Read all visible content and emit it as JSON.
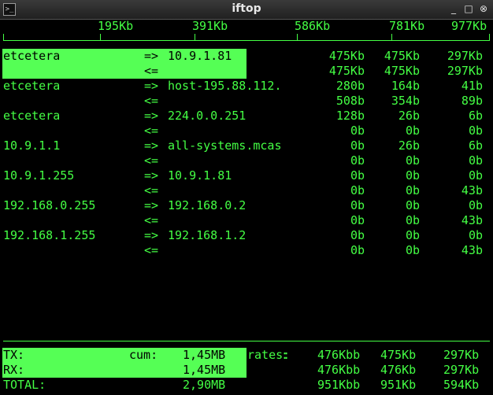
{
  "window": {
    "title": "iftop",
    "buttons": [
      "_",
      "□",
      "⊗"
    ]
  },
  "scale": {
    "ticks": [
      "195Kb",
      "391Kb",
      "586Kb",
      "781Kb",
      "977Kb"
    ]
  },
  "flows": [
    {
      "src": "etcetera",
      "dst": "10.9.1.81",
      "tx": [
        "475Kb",
        "475Kb",
        "297Kb"
      ],
      "rx": [
        "475Kb",
        "475Kb",
        "297Kb"
      ]
    },
    {
      "src": "etcetera",
      "dst": "host-195.88.112.",
      "tx": [
        "280b",
        "164b",
        "41b"
      ],
      "rx": [
        "508b",
        "354b",
        "89b"
      ]
    },
    {
      "src": "etcetera",
      "dst": "224.0.0.251",
      "tx": [
        "128b",
        "26b",
        "6b"
      ],
      "rx": [
        "0b",
        "0b",
        "0b"
      ]
    },
    {
      "src": "10.9.1.1",
      "dst": "all-systems.mcas",
      "tx": [
        "0b",
        "26b",
        "6b"
      ],
      "rx": [
        "0b",
        "0b",
        "0b"
      ]
    },
    {
      "src": "10.9.1.255",
      "dst": "10.9.1.81",
      "tx": [
        "0b",
        "0b",
        "0b"
      ],
      "rx": [
        "0b",
        "0b",
        "43b"
      ]
    },
    {
      "src": "192.168.0.255",
      "dst": "192.168.0.2",
      "tx": [
        "0b",
        "0b",
        "0b"
      ],
      "rx": [
        "0b",
        "0b",
        "43b"
      ]
    },
    {
      "src": "192.168.1.255",
      "dst": "192.168.1.2",
      "tx": [
        "0b",
        "0b",
        "0b"
      ],
      "rx": [
        "0b",
        "0b",
        "43b"
      ]
    }
  ],
  "arrows": {
    "out": "=>",
    "in": "<="
  },
  "totals": {
    "tx_label": "TX:",
    "rx_label": "RX:",
    "total_label": "TOTAL:",
    "cum_label": "cum:",
    "rates_label": "rates:",
    "tx_cum": "1,45MB",
    "rx_cum": "1,45MB",
    "total_cum": "2,90MB",
    "tx_rates": [
      "476Kbb",
      "475Kb",
      "297Kb"
    ],
    "rx_rates": [
      "476Kbb",
      "476Kb",
      "297Kb"
    ],
    "total_rates": [
      "951Kbb",
      "951Kb",
      "594Kb"
    ]
  },
  "colors": {
    "fg": "#44ff44",
    "highlight": "#55ff55",
    "bg": "#000000"
  }
}
